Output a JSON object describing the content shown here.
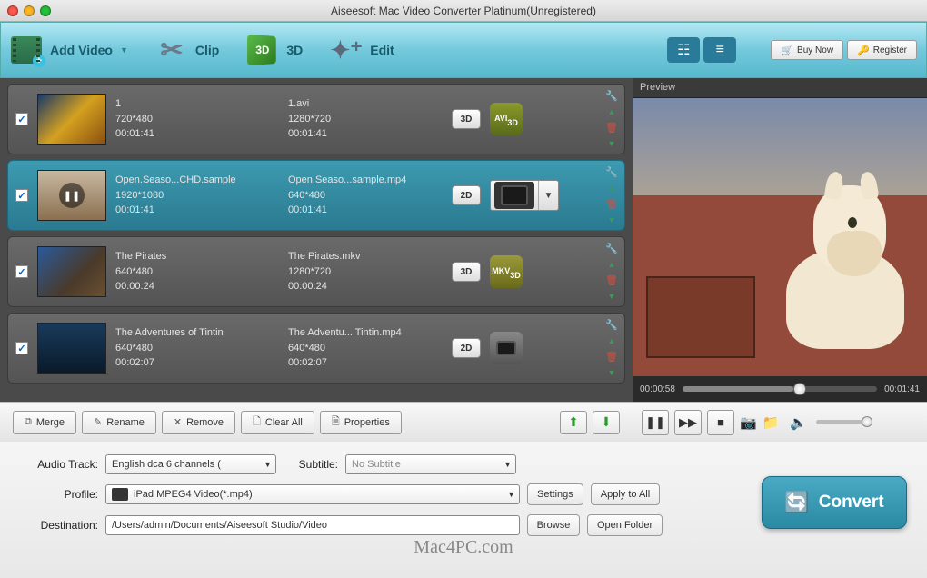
{
  "window": {
    "title": "Aiseesoft Mac Video Converter Platinum(Unregistered)"
  },
  "toolbar": {
    "add_video": "Add Video",
    "clip": "Clip",
    "three_d": "3D",
    "edit": "Edit",
    "buy_now": "Buy Now",
    "register": "Register"
  },
  "preview": {
    "label": "Preview",
    "current_time": "00:00:58",
    "total_time": "00:01:41"
  },
  "items": [
    {
      "checked": true,
      "src_name": "1",
      "src_res": "720*480",
      "src_dur": "00:01:41",
      "out_name": "1.avi",
      "out_res": "1280*720",
      "out_dur": "00:01:41",
      "dim_badge": "3D",
      "fmt_label": "AVI",
      "fmt_style": "avi"
    },
    {
      "checked": true,
      "selected": true,
      "src_name": "Open.Seaso...CHD.sample",
      "src_res": "1920*1080",
      "src_dur": "00:01:41",
      "out_name": "Open.Seaso...sample.mp4",
      "out_res": "640*480",
      "out_dur": "00:01:41",
      "dim_badge": "2D",
      "profile_dropdown": true
    },
    {
      "checked": true,
      "src_name": "The Pirates",
      "src_res": "640*480",
      "src_dur": "00:00:24",
      "out_name": "The Pirates.mkv",
      "out_res": "1280*720",
      "out_dur": "00:00:24",
      "dim_badge": "3D",
      "fmt_label": "MKV",
      "fmt_style": "mkv"
    },
    {
      "checked": true,
      "src_name": "The Adventures of Tintin",
      "src_res": "640*480",
      "src_dur": "00:02:07",
      "out_name": "The Adventu... Tintin.mp4",
      "out_res": "640*480",
      "out_dur": "00:02:07",
      "dim_badge": "2D",
      "fmt_style": "ipad"
    }
  ],
  "list_toolbar": {
    "merge": "Merge",
    "rename": "Rename",
    "remove": "Remove",
    "clear_all": "Clear All",
    "properties": "Properties"
  },
  "settings": {
    "audio_track_label": "Audio Track:",
    "audio_track_value": "English dca 6 channels (",
    "subtitle_label": "Subtitle:",
    "subtitle_value": "No Subtitle",
    "profile_label": "Profile:",
    "profile_value": "iPad MPEG4 Video(*.mp4)",
    "destination_label": "Destination:",
    "destination_value": "/Users/admin/Documents/Aiseesoft Studio/Video",
    "settings_btn": "Settings",
    "apply_all_btn": "Apply to All",
    "browse_btn": "Browse",
    "open_folder_btn": "Open Folder",
    "convert_btn": "Convert"
  },
  "watermark": "Mac4PC.com"
}
